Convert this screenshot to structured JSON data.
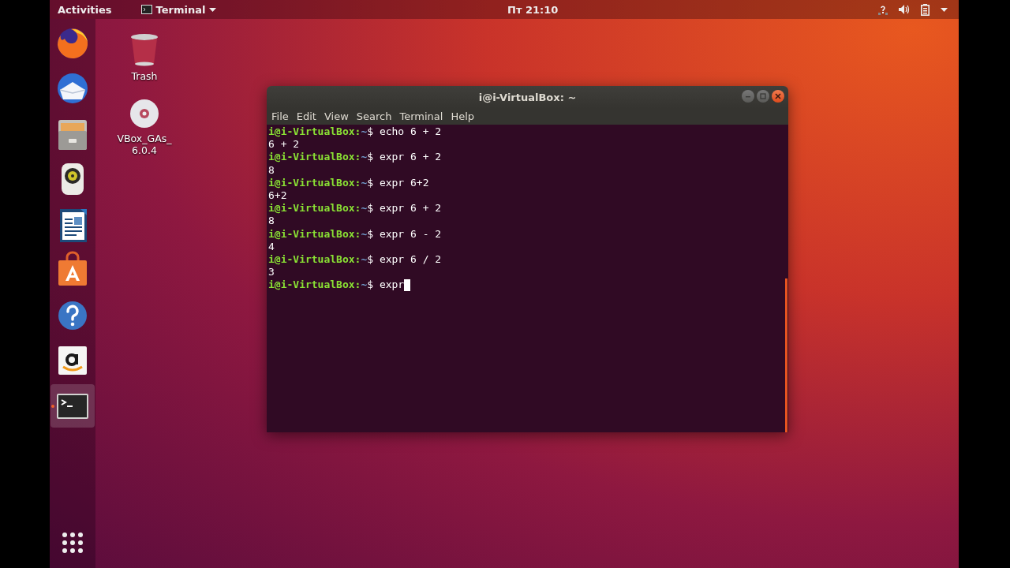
{
  "top_bar": {
    "activities": "Activities",
    "app_menu": "Terminal",
    "clock": "Пт 21:10"
  },
  "dock": {
    "items": [
      {
        "kind": "firefox",
        "selected": false
      },
      {
        "kind": "mail",
        "selected": false
      },
      {
        "kind": "files",
        "selected": false
      },
      {
        "kind": "speaker",
        "selected": false
      },
      {
        "kind": "writer",
        "selected": false
      },
      {
        "kind": "store",
        "selected": false
      },
      {
        "kind": "help",
        "selected": false
      },
      {
        "kind": "amazon",
        "selected": false
      },
      {
        "kind": "terminal",
        "selected": true
      }
    ]
  },
  "desktop_icons": [
    {
      "kind": "trash",
      "label_lines": [
        "Trash"
      ]
    },
    {
      "kind": "disc",
      "label_lines": [
        "VBox_GAs_",
        "6.0.4"
      ]
    }
  ],
  "terminal": {
    "title": "i@i-VirtualBox: ~",
    "menu": [
      "File",
      "Edit",
      "View",
      "Search",
      "Terminal",
      "Help"
    ],
    "lines": [
      {
        "kind": "prompt",
        "user": "i@i-VirtualBox:",
        "path": "~",
        "sign": "$",
        "command": "echo 6 + 2"
      },
      {
        "kind": "output",
        "text": "6 + 2"
      },
      {
        "kind": "prompt",
        "user": "i@i-VirtualBox:",
        "path": "~",
        "sign": "$",
        "command": "expr 6 + 2"
      },
      {
        "kind": "output",
        "text": "8"
      },
      {
        "kind": "prompt",
        "user": "i@i-VirtualBox:",
        "path": "~",
        "sign": "$",
        "command": "expr 6+2"
      },
      {
        "kind": "output",
        "text": "6+2"
      },
      {
        "kind": "prompt",
        "user": "i@i-VirtualBox:",
        "path": "~",
        "sign": "$",
        "command": "expr 6 + 2"
      },
      {
        "kind": "output",
        "text": "8"
      },
      {
        "kind": "prompt",
        "user": "i@i-VirtualBox:",
        "path": "~",
        "sign": "$",
        "command": "expr 6 - 2"
      },
      {
        "kind": "output",
        "text": "4"
      },
      {
        "kind": "prompt",
        "user": "i@i-VirtualBox:",
        "path": "~",
        "sign": "$",
        "command": "expr 6 / 2"
      },
      {
        "kind": "output",
        "text": "3"
      },
      {
        "kind": "prompt",
        "user": "i@i-VirtualBox:",
        "path": "~",
        "sign": "$",
        "command": "expr",
        "cursor": true
      }
    ]
  }
}
